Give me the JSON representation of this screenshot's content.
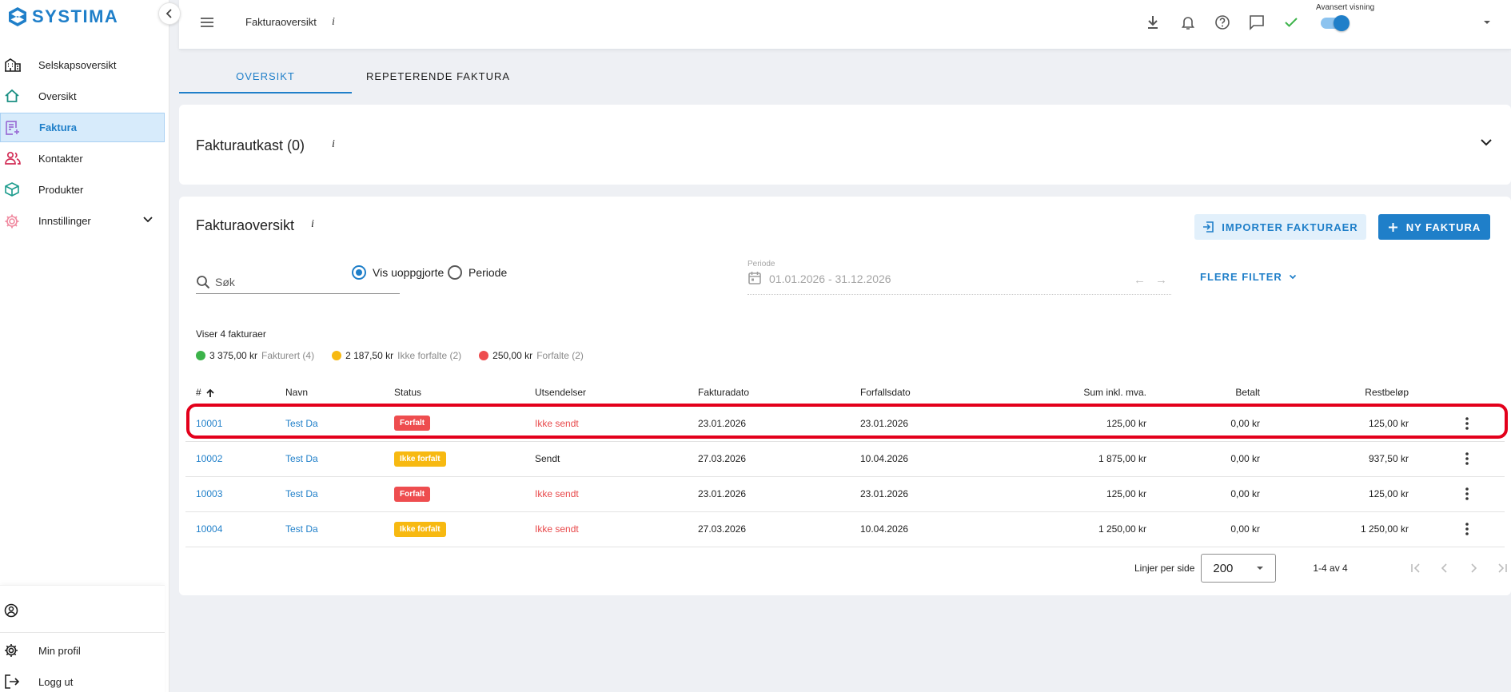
{
  "app": {
    "logo": "SYSTIMA"
  },
  "sidebar": {
    "items": [
      {
        "label": "Selskapsoversikt",
        "icon": "company-icon"
      },
      {
        "label": "Oversikt",
        "icon": "home-icon"
      },
      {
        "label": "Faktura",
        "icon": "invoice-icon",
        "active": true
      },
      {
        "label": "Kontakter",
        "icon": "contacts-icon"
      },
      {
        "label": "Produkter",
        "icon": "product-icon"
      },
      {
        "label": "Innstillinger",
        "icon": "settings-icon"
      }
    ],
    "bottom": [
      {
        "label": "Min profil",
        "icon": "gear-icon"
      },
      {
        "label": "Logg ut",
        "icon": "logout-icon"
      }
    ]
  },
  "topbar": {
    "title": "Fakturaoversikt",
    "info": "i",
    "toggle_label": "Avansert visning",
    "toggle_on": true
  },
  "tabs": [
    {
      "label": "OVERSIKT",
      "active": true
    },
    {
      "label": "REPETERENDE FAKTURA",
      "active": false
    }
  ],
  "drafts": {
    "title": "Fakturautkast (0)",
    "info": "i"
  },
  "overview": {
    "title": "Fakturaoversikt",
    "info": "i",
    "import_label": "IMPORTER FAKTURAER",
    "new_label": "NY FAKTURA",
    "search_placeholder": "Søk",
    "radio_unsettled": "Vis uoppgjorte",
    "radio_period": "Periode",
    "period_label": "Periode",
    "period_value": "01.01.2026 - 31.12.2026",
    "more_filters": "FLERE FILTER",
    "count_text": "Viser 4 fakturaer",
    "legend": [
      {
        "amount": "3 375,00 kr",
        "label": "Fakturert (4)",
        "color": "#3cb34a"
      },
      {
        "amount": "2 187,50 kr",
        "label": "Ikke forfalte (2)",
        "color": "#f7b911"
      },
      {
        "amount": "250,00 kr",
        "label": "Forfalte (2)",
        "color": "#ee4d4f"
      }
    ]
  },
  "table": {
    "headers": {
      "num": "#",
      "name": "Navn",
      "status": "Status",
      "sendings": "Utsendelser",
      "invoice_date": "Fakturadato",
      "due_date": "Forfallsdato",
      "sum": "Sum inkl. mva.",
      "paid": "Betalt",
      "rest": "Restbeløp"
    },
    "rows": [
      {
        "num": "10001",
        "name": "Test Da",
        "status": "Forfalt",
        "status_type": "overdue",
        "sending": "Ikke sendt",
        "sent": false,
        "invoice_date": "23.01.2026",
        "due_date": "23.01.2026",
        "sum": "125,00 kr",
        "paid": "0,00 kr",
        "rest": "125,00 kr"
      },
      {
        "num": "10002",
        "name": "Test Da",
        "status": "Ikke forfalt",
        "status_type": "not-due",
        "sending": "Sendt",
        "sent": true,
        "invoice_date": "27.03.2026",
        "due_date": "10.04.2026",
        "sum": "1 875,00 kr",
        "paid": "0,00 kr",
        "rest": "937,50 kr"
      },
      {
        "num": "10003",
        "name": "Test Da",
        "status": "Forfalt",
        "status_type": "overdue",
        "sending": "Ikke sendt",
        "sent": false,
        "invoice_date": "23.01.2026",
        "due_date": "23.01.2026",
        "sum": "125,00 kr",
        "paid": "0,00 kr",
        "rest": "125,00 kr"
      },
      {
        "num": "10004",
        "name": "Test Da",
        "status": "Ikke forfalt",
        "status_type": "not-due",
        "sending": "Ikke sendt",
        "sent": false,
        "invoice_date": "27.03.2026",
        "due_date": "10.04.2026",
        "sum": "1 250,00 kr",
        "paid": "0,00 kr",
        "rest": "1 250,00 kr"
      }
    ]
  },
  "pagination": {
    "lines_label": "Linjer per side",
    "lines_value": "200",
    "range": "1-4 av 4"
  },
  "colors": {
    "accent": "#1f7fc9",
    "overdue": "#ee4d4f",
    "not_due": "#f7b911",
    "highlight": "#e3001b"
  }
}
